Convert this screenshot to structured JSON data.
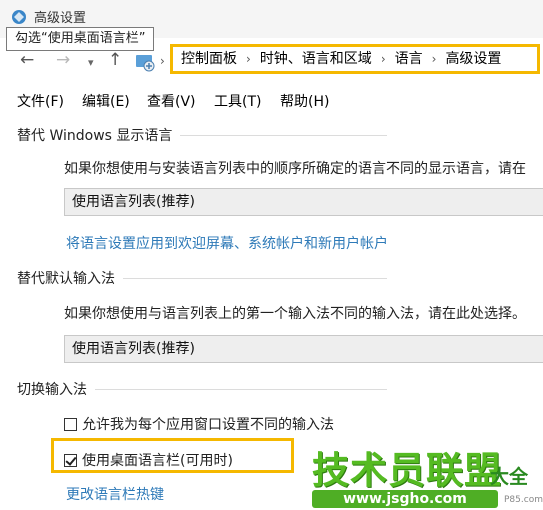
{
  "window": {
    "title": "高级设置",
    "tooltip": "勾选“使用桌面语言栏”"
  },
  "nav": {
    "back_icon": "back-arrow-icon",
    "forward_icon": "forward-arrow-icon",
    "recent_icon": "chevron-down-icon",
    "up_icon": "up-arrow-icon",
    "breadcrumb": [
      "控制面板",
      "时钟、语言和区域",
      "语言",
      "高级设置"
    ]
  },
  "menu": {
    "file": "文件(F)",
    "edit": "编辑(E)",
    "view": "查看(V)",
    "tools": "工具(T)",
    "help": "帮助(H)"
  },
  "display_language": {
    "heading": "替代 Windows 显示语言",
    "description": "如果你想使用与安装语言列表中的顺序所确定的语言不同的显示语言，请在",
    "selected": "使用语言列表(推荐)",
    "link": "将语言设置应用到欢迎屏幕、系统帐户和新用户帐户"
  },
  "input_method": {
    "heading": "替代默认输入法",
    "description": "如果你想使用与语言列表上的第一个输入法不同的输入法，请在此处选择。",
    "selected": "使用语言列表(推荐)"
  },
  "switch_input": {
    "heading": "切换输入法",
    "per_app_label": "允许我为每个应用窗口设置不同的输入法",
    "per_app_checked": false,
    "desktop_bar_label": "使用桌面语言栏(可用时)",
    "desktop_bar_checked": true,
    "hotkey_link": "更改语言栏热键"
  },
  "watermark": {
    "main": "技术员联盟",
    "side": "大全",
    "url": "www.jsgho.com",
    "small": "P85.com"
  },
  "colors": {
    "highlight": "#f5b800",
    "link": "#2e7ab8",
    "watermark_green": "#55bb22"
  }
}
